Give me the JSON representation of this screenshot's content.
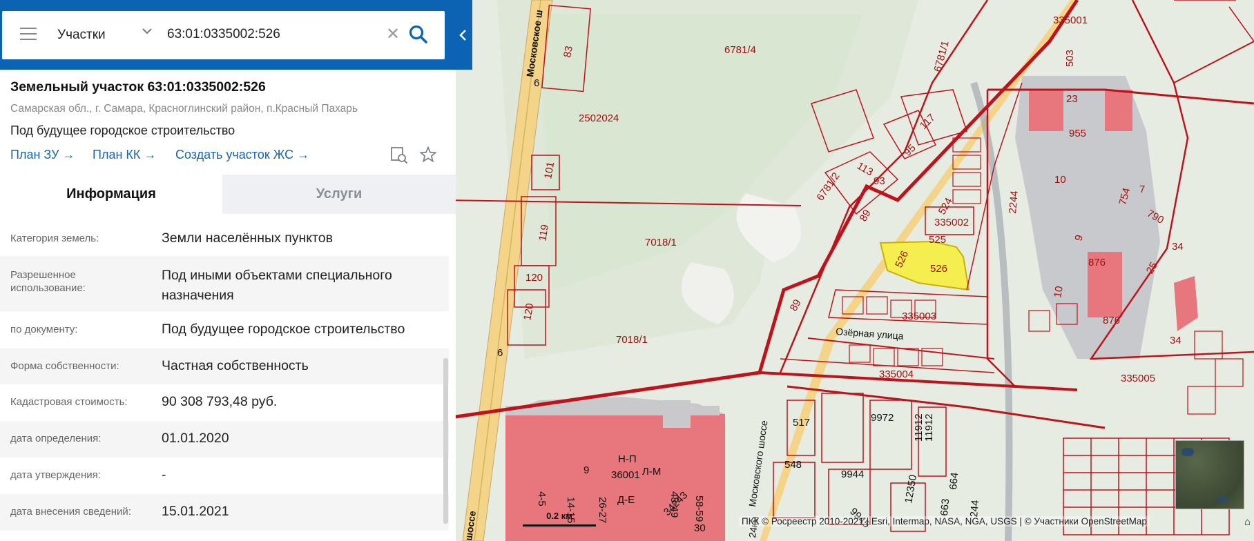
{
  "search": {
    "type_label": "Участки",
    "query": "63:01:0335002:526",
    "clear_symbol": "✕"
  },
  "parcel": {
    "title": "Земельный участок 63:01:0335002:526",
    "address": "Самарская обл., г. Самара, Красноглинский район, п.Красный Пахарь",
    "purpose": "Под будущее городское строительство",
    "links": {
      "plan_zu": "План ЗУ →",
      "plan_kk": "План КК →",
      "create_zs": "Создать участок ЖС →"
    }
  },
  "tabs": {
    "info": "Информация",
    "services": "Услуги"
  },
  "properties": [
    {
      "key": "Категория земель:",
      "value": "Земли населённых пунктов"
    },
    {
      "key": "Разрешенное использование:",
      "value": "Под иными объектами специального назначения"
    },
    {
      "key": "по документу:",
      "value": "Под будущее городское строительство"
    },
    {
      "key": "Форма собственности:",
      "value": "Частная собственность"
    },
    {
      "key": "Кадастровая стоимость:",
      "value": "90 308 793,48 руб."
    },
    {
      "key": "дата определения:",
      "value": "01.01.2020"
    },
    {
      "key": "дата утверждения:",
      "value": "-"
    },
    {
      "key": "дата внесения сведений:",
      "value": "15.01.2021"
    }
  ],
  "map": {
    "labels": [
      "335001",
      "6781/4",
      "6781/1",
      "117",
      "95",
      "113",
      "93",
      "6781/2",
      "2502024",
      "7018/1",
      "7018/1",
      "89",
      "89",
      "524",
      "335002",
      "525",
      "526",
      "526",
      "335003",
      "335004",
      "335005",
      "Озёрная улица",
      "Московское ш",
      "Московского шоссе",
      "24км",
      "шоссе",
      "83",
      "101",
      "119",
      "120",
      "120",
      "6",
      "6",
      "503",
      "23",
      "955",
      "10",
      "754",
      "7",
      "790",
      "9",
      "876",
      "876",
      "25",
      "34",
      "34",
      "10",
      "2244",
      "517",
      "9972",
      "11912",
      "11912",
      "548",
      "9944",
      "12350",
      "9945",
      "664",
      "663",
      "244",
      "Н-П",
      "36001",
      "Л-М",
      "9",
      "26-27",
      "14-15",
      "4-5",
      "48-49",
      "58-59",
      "Д-Е",
      "34243",
      "30"
    ],
    "scale_label": "0.2 км",
    "attribution": "ПКК © Росреестр 2010-2021 | Esri, Intermap, NASA, NGA, USGS | © Участники OpenStreetMap",
    "colors": {
      "boundary": "#c0121b",
      "selected_fill": "#f5ee4f",
      "building_fill": "#e8777d",
      "road_fill": "#f3d488",
      "accent": "#0c63b4"
    }
  }
}
